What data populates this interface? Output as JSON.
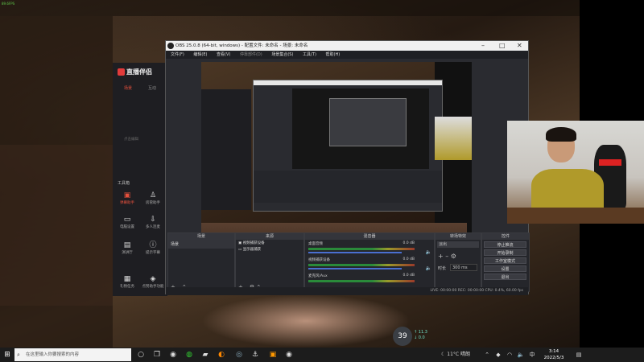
{
  "corner_text": "89.6FPS",
  "assistant": {
    "logo": "直播伴侣",
    "tab_active": "场景",
    "tab2": "互动",
    "hint": "点击编辑",
    "section_title": "工具箱",
    "tools": [
      {
        "label": "弹幕助手",
        "icon": "camera-icon",
        "active": true
      },
      {
        "label": "房管助手",
        "icon": "person-icon",
        "active": false
      },
      {
        "label": "电脑设置",
        "icon": "monitor-icon",
        "active": false
      },
      {
        "label": "多人连麦",
        "icon": "download-icon",
        "active": false
      },
      {
        "label": "演讲厅",
        "icon": "board-icon",
        "active": false
      },
      {
        "label": "提示字幕",
        "icon": "info-icon",
        "active": false
      },
      {
        "label": "礼物任务",
        "icon": "gift-icon",
        "active": false
      },
      {
        "label": "点赞助手功能",
        "icon": "controller-icon",
        "active": false
      }
    ]
  },
  "obs": {
    "title": "OBS 25.0.8 (64-bit, windows) - 配置文件: 未命名 - 场景: 未命名",
    "menu": [
      "文件(F)",
      "编辑(E)",
      "查看(V)",
      "停靠部件(D)",
      "场景集合(S)",
      "工具(T)",
      "帮助(H)"
    ],
    "docks": {
      "scenes": {
        "title": "场景",
        "items": [
          "场景"
        ]
      },
      "sources": {
        "title": "来源",
        "items": [
          "视频捕获设备",
          "显示器捕获"
        ]
      },
      "mixer": {
        "title": "混音器",
        "channels": [
          {
            "name": "桌面音频",
            "db": "0.0 dB"
          },
          {
            "name": "视频捕获设备",
            "db": "0.0 dB"
          },
          {
            "name": "麦克风/Aux",
            "db": "0.0 dB"
          }
        ]
      },
      "transitions": {
        "title": "转场特效",
        "type": "淡出",
        "duration_label": "时长",
        "duration": "300 ms"
      },
      "controls": {
        "title": "控件",
        "buttons": [
          "停止推流",
          "开始录制",
          "工作室模式",
          "设置",
          "退出"
        ]
      }
    },
    "status": "LIVE: 00:00:00  REC: 00:00:00  CPU: 0.4%, 60.00 fps"
  },
  "overlay": {
    "fps": "39",
    "net_up": "11.3",
    "net_down": "0.0"
  },
  "taskbar": {
    "search_placeholder": "在这里输入你要搜索的内容",
    "weather": "11°C 晴朗",
    "time": "3:14",
    "date": "2022/5/3"
  },
  "colors": {
    "accent": "#e6503c",
    "obs_bg": "#2a2b30",
    "taskbar": "#1c1c1c"
  }
}
